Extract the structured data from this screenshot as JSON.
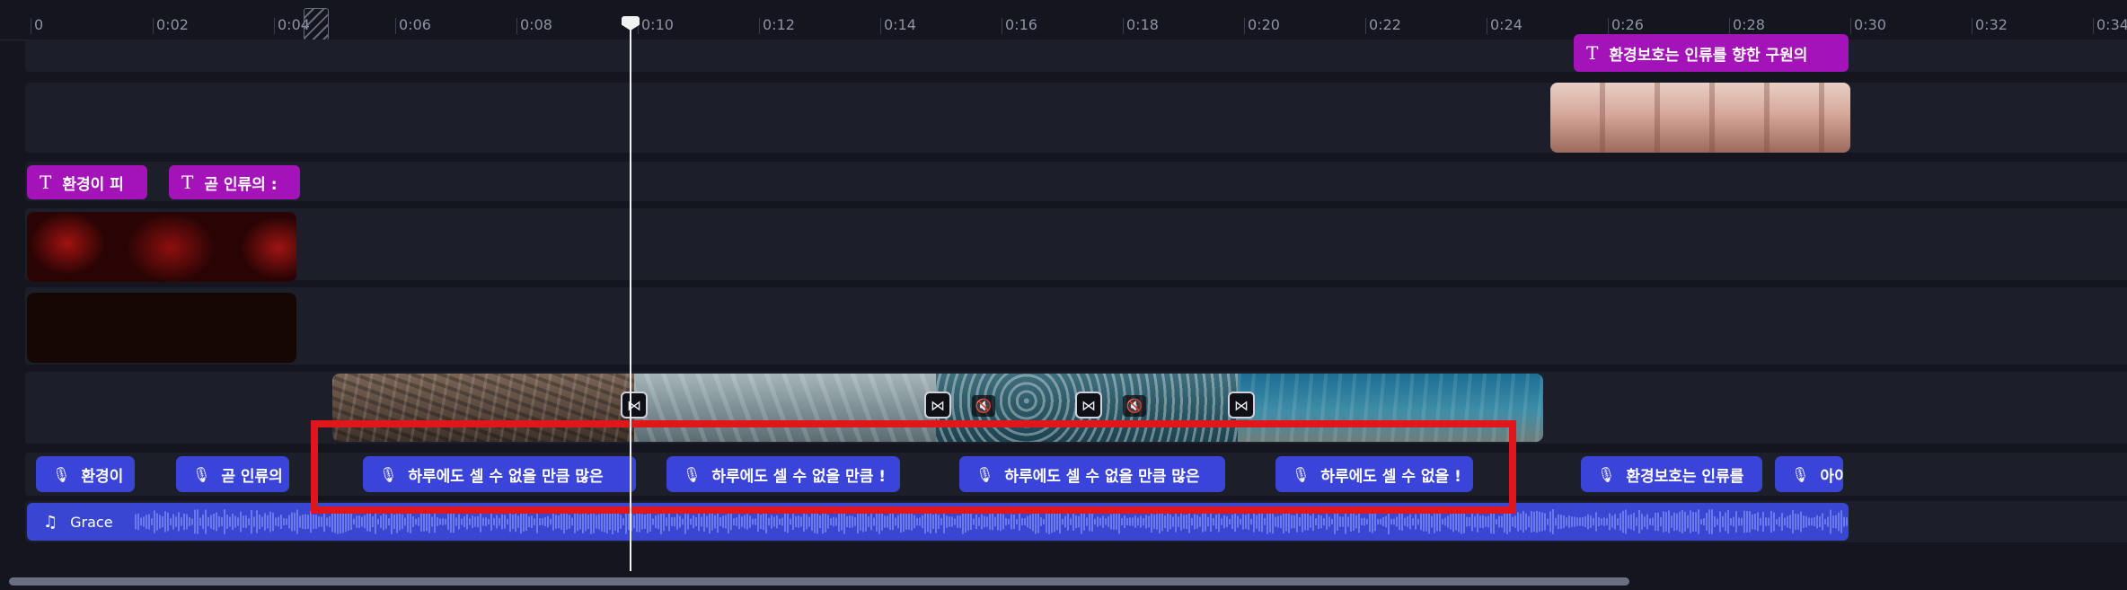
{
  "ruler": {
    "ticks": [
      "0",
      "0:02",
      "0:04",
      "0:06",
      "0:08",
      "0:10",
      "0:12",
      "0:14",
      "0:16",
      "0:18",
      "0:20",
      "0:22",
      "0:24",
      "0:26",
      "0:28",
      "0:30",
      "0:32",
      "0:34"
    ]
  },
  "text_clips": [
    {
      "label": "환경보호는 인류를 향한 구원의"
    },
    {
      "label": "환경이 피"
    },
    {
      "label": "곧 인류의 :"
    }
  ],
  "icons": {
    "text": "T",
    "mic": "🎙",
    "music": "♫",
    "transition": "⋈",
    "mute": "🔇"
  },
  "voice_clips": [
    {
      "label": "환경이"
    },
    {
      "label": "곧 인류의"
    },
    {
      "label": "하루에도 셀 수 없을 만큼 많은"
    },
    {
      "label": "하루에도 셀 수 없을 만큼 !"
    },
    {
      "label": "하루에도 셀 수 없을 만큼 많은"
    },
    {
      "label": "하루에도 셀 수 없을 !"
    },
    {
      "label": "환경보호는 인류를"
    },
    {
      "label": "아이"
    }
  ],
  "audio_track": {
    "label": "Grace"
  },
  "colors": {
    "background": "#14151f",
    "track": "#1c1e2a",
    "text_clip": "#a313b8",
    "voice_clip": "#3a44d8",
    "audio_clip": "#3846d2",
    "highlight": "#e1161b",
    "playhead": "#f2f2f2"
  }
}
